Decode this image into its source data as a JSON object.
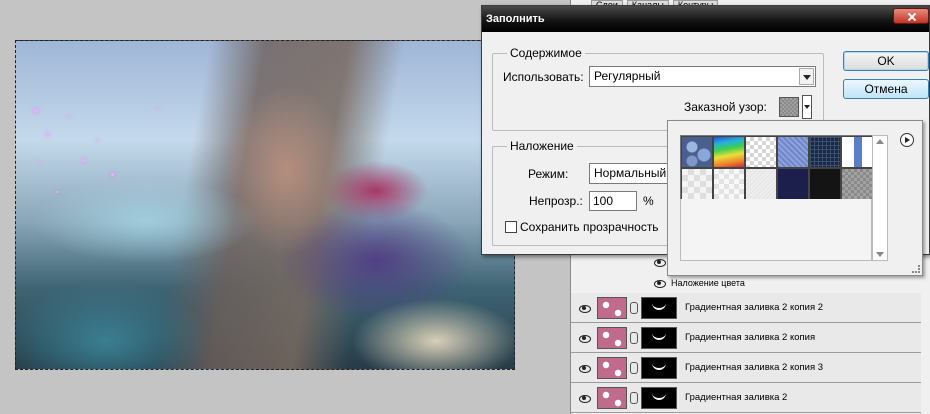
{
  "dialog": {
    "title": "Заполнить",
    "ok_label": "OK",
    "cancel_label": "Отмена",
    "contents": {
      "legend": "Содержимое",
      "use_label": "Использовать:",
      "use_value": "Регулярный",
      "custom_pattern_label": "Заказной узор:"
    },
    "blending": {
      "legend": "Наложение",
      "mode_label": "Режим:",
      "mode_value": "Нормальный",
      "opacity_label": "Непрозр.:",
      "opacity_value": "100",
      "opacity_unit": "%",
      "preserve_transparency_label": "Сохранить прозрачность",
      "preserve_transparency_checked": false
    }
  },
  "pattern_picker": {
    "patterns": [
      {
        "icon": "bubbles-pattern-icon"
      },
      {
        "icon": "rainbow-pattern-icon"
      },
      {
        "icon": "white-checker-pattern-icon"
      },
      {
        "icon": "blue-texture-pattern-icon"
      },
      {
        "icon": "dark-grid-pattern-icon"
      },
      {
        "icon": "blue-stripe-pattern-icon"
      },
      {
        "icon": "light-checker-pattern-icon"
      },
      {
        "icon": "light-checker-pattern-2-icon"
      },
      {
        "icon": "light-noise-pattern-icon"
      },
      {
        "icon": "navy-pattern-icon"
      },
      {
        "icon": "black-pattern-icon"
      },
      {
        "icon": "gray-checker-pattern-icon"
      }
    ]
  },
  "layers_panel": {
    "tabs": [
      "Слои",
      "Каналы",
      "Контуры"
    ],
    "effect_label": "Наложение цвета",
    "layers": [
      {
        "name": "Градиентная заливка 2 копия 2"
      },
      {
        "name": "Градиентная заливка 2 копия"
      },
      {
        "name": "Градиентная заливка 2 копия 3"
      },
      {
        "name": "Градиентная заливка 2"
      }
    ]
  },
  "colors": {
    "titlebar": "#000000",
    "layer_thumb": "#c06a8c",
    "accent_border": "#3c7fb1"
  }
}
